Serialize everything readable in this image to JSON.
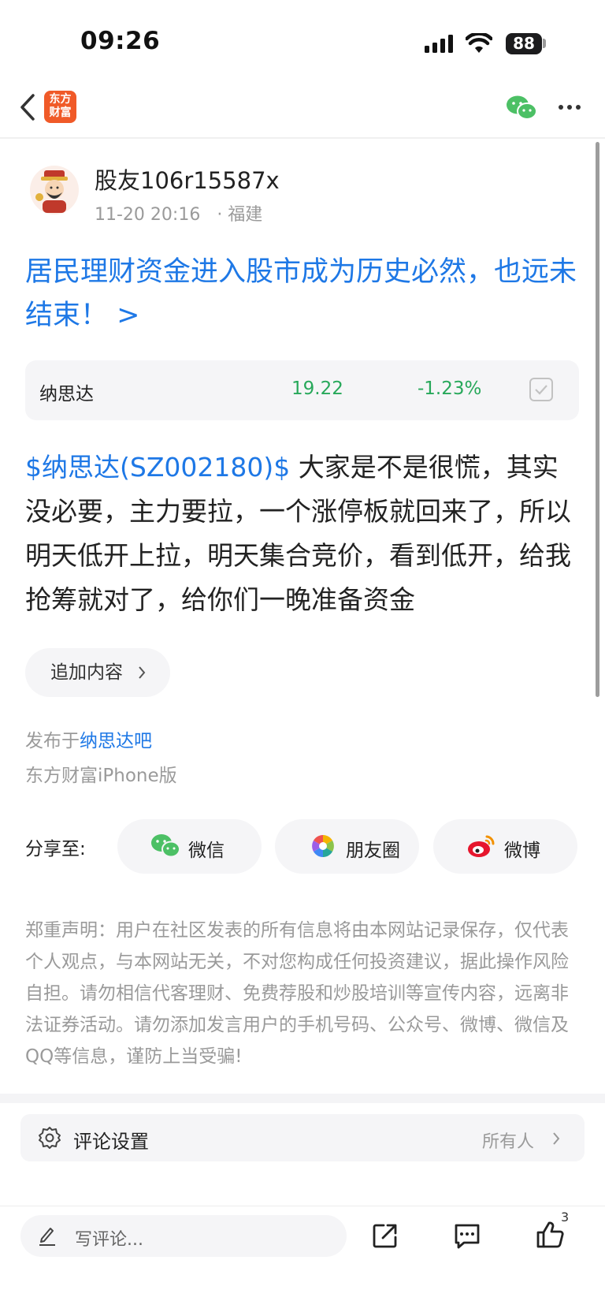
{
  "status_bar": {
    "time": "09:26",
    "battery": "88"
  },
  "nav": {
    "logo_line1": "东方",
    "logo_line2": "财富"
  },
  "post": {
    "author": "股友106r15587x",
    "time": "11-20 20:16",
    "location": "· 福建",
    "title": "居民理财资金进入股市成为历史必然，也远未结束！ >",
    "body_tag": "$纳思达(SZ002180)$",
    "body_text": " 大家是不是很慌，其实没必要，主力要拉，一个涨停板就回来了，所以明天低开上拉，明天集合竞价，看到低开，给我抢筹就对了，给你们一晚准备资金"
  },
  "stock": {
    "name": "纳思达",
    "price": "19.22",
    "change": "-1.23%"
  },
  "append_label": "追加内容",
  "published_prefix": "发布于",
  "published_forum": "纳思达吧",
  "client": "东方财富iPhone版",
  "share": {
    "label": "分享至:",
    "items": [
      {
        "label": "微信",
        "icon": "wechat-icon"
      },
      {
        "label": "朋友圈",
        "icon": "moments-icon"
      },
      {
        "label": "微博",
        "icon": "weibo-icon"
      }
    ]
  },
  "disclaimer": "郑重声明：用户在社区发表的所有信息将由本网站记录保存，仅代表个人观点，与本网站无关，不对您构成任何投资建议，据此操作风险自担。请勿相信代客理财、免费荐股和炒股培训等宣传内容，远离非法证券活动。请勿添加发言用户的手机号码、公众号、微博、微信及QQ等信息，谨防上当受骗!",
  "comment_setting": {
    "label": "评论设置",
    "value": "所有人"
  },
  "bottom_bar": {
    "placeholder": "写评论...",
    "like_count": "3"
  },
  "colors": {
    "link": "#1e78e6",
    "up_down": "#27a85a",
    "brand": "#f05a28",
    "wechat": "#4cc065"
  }
}
